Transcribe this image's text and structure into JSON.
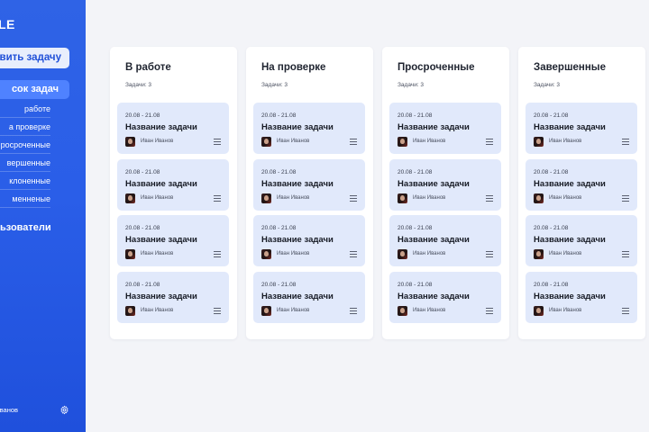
{
  "sidebar": {
    "logo": "LE",
    "create_button": "авить задачу",
    "active_nav": "сок задач",
    "subnav": [
      "работе",
      "а проверке",
      "росроченные",
      "вершенные",
      "клоненные",
      "менненые"
    ],
    "users_link": "ьзователи",
    "footer_user": "ванов",
    "settings_icon": "gear-icon"
  },
  "colors": {
    "sidebar_top": "#2f63e6",
    "sidebar_bottom": "#1f50dc",
    "active_nav_bg": "#4f82ff",
    "card_bg": "#e1e9fb",
    "page_bg": "#f3f4f8"
  },
  "columns": [
    {
      "title": "В работе",
      "count_label": "Задачи: 3",
      "cards": [
        {
          "date": "20.08 - 21.08",
          "title": "Название задачи",
          "user": "Иван Иванов"
        },
        {
          "date": "20.08 - 21.08",
          "title": "Название задачи",
          "user": "Иван Иванов"
        },
        {
          "date": "20.08 - 21.08",
          "title": "Название задачи",
          "user": "Иван Иванов"
        },
        {
          "date": "20.08 - 21.08",
          "title": "Название задачи",
          "user": "Иван Иванов"
        }
      ]
    },
    {
      "title": "На проверке",
      "count_label": "Задачи: 3",
      "cards": [
        {
          "date": "20.08 - 21.08",
          "title": "Название задачи",
          "user": "Иван Иванов"
        },
        {
          "date": "20.08 - 21.08",
          "title": "Название задачи",
          "user": "Иван Иванов"
        },
        {
          "date": "20.08 - 21.08",
          "title": "Название задачи",
          "user": "Иван Иванов"
        },
        {
          "date": "20.08 - 21.08",
          "title": "Название задачи",
          "user": "Иван Иванов"
        }
      ]
    },
    {
      "title": "Просроченные",
      "count_label": "Задачи: 3",
      "cards": [
        {
          "date": "20.08 - 21.08",
          "title": "Название задачи",
          "user": "Иван Иванов"
        },
        {
          "date": "20.08 - 21.08",
          "title": "Название задачи",
          "user": "Иван Иванов"
        },
        {
          "date": "20.08 - 21.08",
          "title": "Название задачи",
          "user": "Иван Иванов"
        },
        {
          "date": "20.08 - 21.08",
          "title": "Название задачи",
          "user": "Иван Иванов"
        }
      ]
    },
    {
      "title": "Завершенные",
      "count_label": "Задачи: 3",
      "cards": [
        {
          "date": "20.08 - 21.08",
          "title": "Название задачи",
          "user": "Иван Иванов"
        },
        {
          "date": "20.08 - 21.08",
          "title": "Название задачи",
          "user": "Иван Иванов"
        },
        {
          "date": "20.08 - 21.08",
          "title": "Название задачи",
          "user": "Иван Иванов"
        },
        {
          "date": "20.08 - 21.08",
          "title": "Название задачи",
          "user": "Иван Иванов"
        }
      ]
    }
  ]
}
